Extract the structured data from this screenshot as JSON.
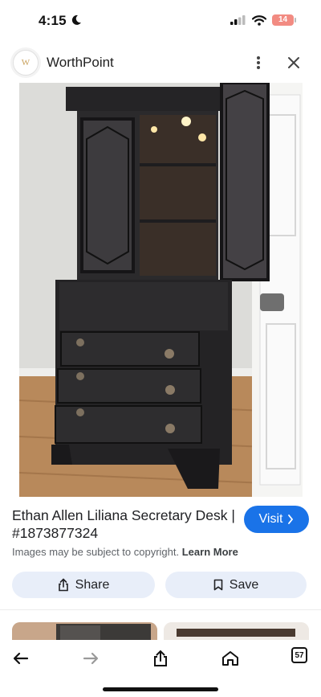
{
  "status_bar": {
    "time": "4:15",
    "battery": "14"
  },
  "app_bar": {
    "site_name": "WorthPoint",
    "logo_letter": "W"
  },
  "result": {
    "title": "Ethan Allen Liliana Secretary Desk | #1873877324",
    "visit_label": "Visit",
    "copyright_text": "Images may be subject to copyright.",
    "learn_more": "Learn More"
  },
  "actions": {
    "share_label": "Share",
    "save_label": "Save"
  },
  "toolbar": {
    "tab_count": "57"
  },
  "colors": {
    "visit_blue": "#1a73e8",
    "action_bg": "#e8eef9",
    "battery_red": "#f28b82"
  },
  "icons": [
    "moon-icon",
    "signal-icon",
    "wifi-icon",
    "more-icon",
    "close-icon",
    "lens-icon",
    "chevron-right-icon",
    "share-icon",
    "bookmark-icon",
    "back-icon",
    "forward-icon",
    "home-icon"
  ]
}
